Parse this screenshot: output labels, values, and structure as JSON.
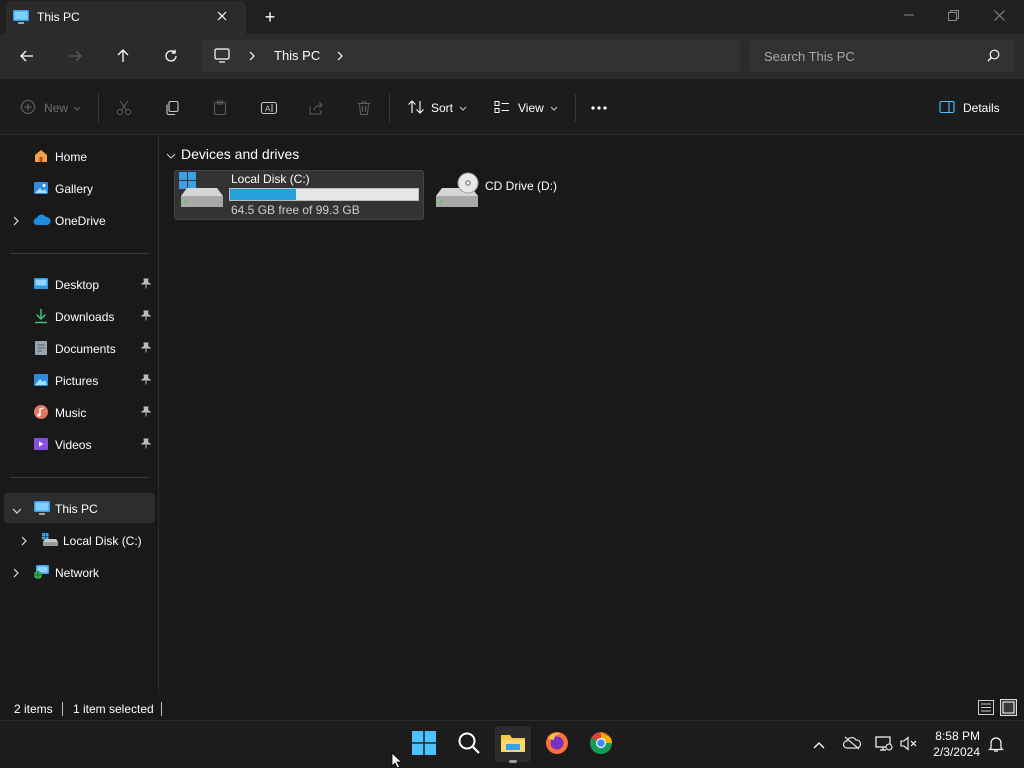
{
  "window": {
    "tab_title": "This PC",
    "new_tab_symbol": "+"
  },
  "nav": {
    "breadcrumb": [
      "This PC"
    ],
    "search_placeholder": "Search This PC"
  },
  "commandbar": {
    "new_label": "New",
    "sort_label": "Sort",
    "view_label": "View",
    "details_label": "Details"
  },
  "sidebar": {
    "top": [
      {
        "label": "Home",
        "icon": "home-icon"
      },
      {
        "label": "Gallery",
        "icon": "gallery-icon"
      },
      {
        "label": "OneDrive",
        "icon": "onedrive-icon"
      }
    ],
    "quick": [
      {
        "label": "Desktop",
        "icon": "desktop-icon"
      },
      {
        "label": "Downloads",
        "icon": "downloads-icon"
      },
      {
        "label": "Documents",
        "icon": "documents-icon"
      },
      {
        "label": "Pictures",
        "icon": "pictures-icon"
      },
      {
        "label": "Music",
        "icon": "music-icon"
      },
      {
        "label": "Videos",
        "icon": "videos-icon"
      }
    ],
    "tree": [
      {
        "label": "This PC",
        "icon": "this-pc-icon"
      },
      {
        "label": "Local Disk (C:)",
        "icon": "local-disk-icon"
      },
      {
        "label": "Network",
        "icon": "network-icon"
      }
    ]
  },
  "content": {
    "group_title": "Devices and drives",
    "drives": [
      {
        "name": "Local Disk (C:)",
        "free_text": "64.5 GB free of 99.3 GB",
        "used_fraction": 0.35
      },
      {
        "name": "CD Drive (D:)"
      }
    ]
  },
  "status": {
    "items": "2 items",
    "selected": "1 item selected"
  },
  "taskbar": {
    "time": "8:58 PM",
    "date": "2/3/2024"
  },
  "colors": {
    "accent": "#4cc2ff",
    "progress": "#26a0da",
    "folder": "#f7c948"
  }
}
